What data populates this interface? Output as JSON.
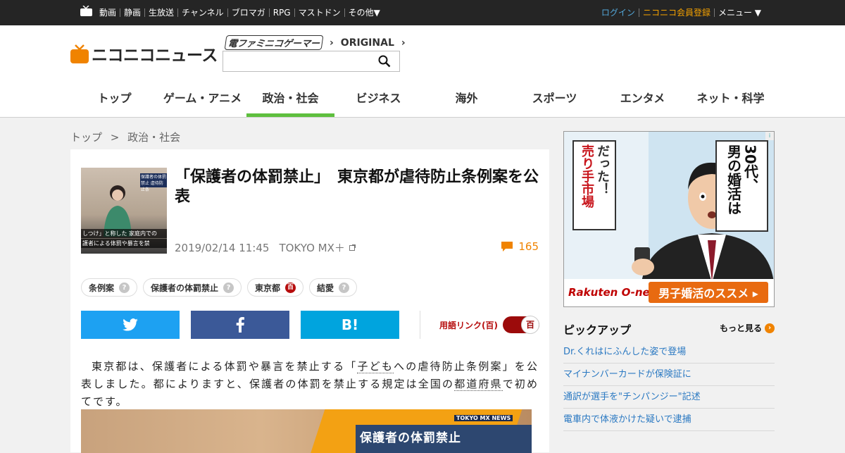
{
  "topbar": {
    "nav": [
      "動画",
      "静画",
      "生放送",
      "チャンネル",
      "ブロマガ",
      "RPG",
      "マストドン",
      "その他▼"
    ],
    "login": "ログイン",
    "register": "ニコニコ会員登録",
    "menu": "メニュー ▼"
  },
  "header": {
    "logo": "ニコニコニュース",
    "partner_famitsu": "電ファミニコゲーマー",
    "partner_original": "ORIGINAL",
    "search": {
      "placeholder": "",
      "value": ""
    },
    "categories": [
      "トップ",
      "ゲーム・アニメ",
      "政治・社会",
      "ビジネス",
      "海外",
      "スポーツ",
      "エンタメ",
      "ネット・科学"
    ],
    "active_category": "政治・社会"
  },
  "breadcrumb": [
    "トップ",
    ">",
    "政治・社会"
  ],
  "article": {
    "thumb_caption_1": "しつけ」と称した 家庭内での",
    "thumb_caption_2": "護者による体罰や暴言を禁",
    "thumb_corner": "保護者の体罰禁止 虐待防止条",
    "title": "「保護者の体罰禁止」　東京都が虐待防止条例案を公表",
    "date": "2019/02/14 11:45",
    "source": "TOKYO MX＋",
    "comment_count": "165",
    "tags": [
      {
        "label": "条例案",
        "mark": "?"
      },
      {
        "label": "保護者の体罰禁止",
        "mark": "?"
      },
      {
        "label": "東京都",
        "mark": "百"
      },
      {
        "label": "結愛",
        "mark": "?"
      }
    ],
    "share": {
      "twitter": "twitter",
      "facebook": "f",
      "hatena": "B!"
    },
    "dict_link_label": "用語リンク(",
    "dict_link_mark": "百",
    "dict_link_label_end": ")",
    "toggle_mark": "百",
    "body_1": "東京都は、保護者による体罰や暴言を禁止する「",
    "body_link_1": "子ども",
    "body_2": "への虐待防止条例案」を公表しました。都によりますと、保護者の体罰を禁止する規定は全国の",
    "body_link_2": "都道府県",
    "body_3": "で初めてです。",
    "image_brand": "TOKYO MX NEWS",
    "image_lower_third": "保護者の体罰禁止"
  },
  "ad": {
    "left_col_1": "だった！",
    "left_col_2": "売り手市場",
    "right_col_1": "30代、",
    "right_col_2": "男の婚活は",
    "rakuten": "Rakuten O-net",
    "cta": "男子婚活のススメ ▸",
    "adchoice": "i"
  },
  "pickup": {
    "title": "ピックアップ",
    "more": "もっと見る",
    "items": [
      "Dr.くれはにふんした姿で登場",
      "マイナンバーカードが保険証に",
      "通訳が選手を\"チンパンジー\"記述",
      "電車内で体液かけた疑いで逮捕"
    ]
  },
  "colors": {
    "accent_orange": "#f08300",
    "nav_active": "#5ebf3e",
    "twitter": "#1da1f2",
    "facebook": "#3b5998",
    "hatena": "#00a4de",
    "dict_red": "#b60d0d",
    "link_blue": "#2b79c2"
  }
}
